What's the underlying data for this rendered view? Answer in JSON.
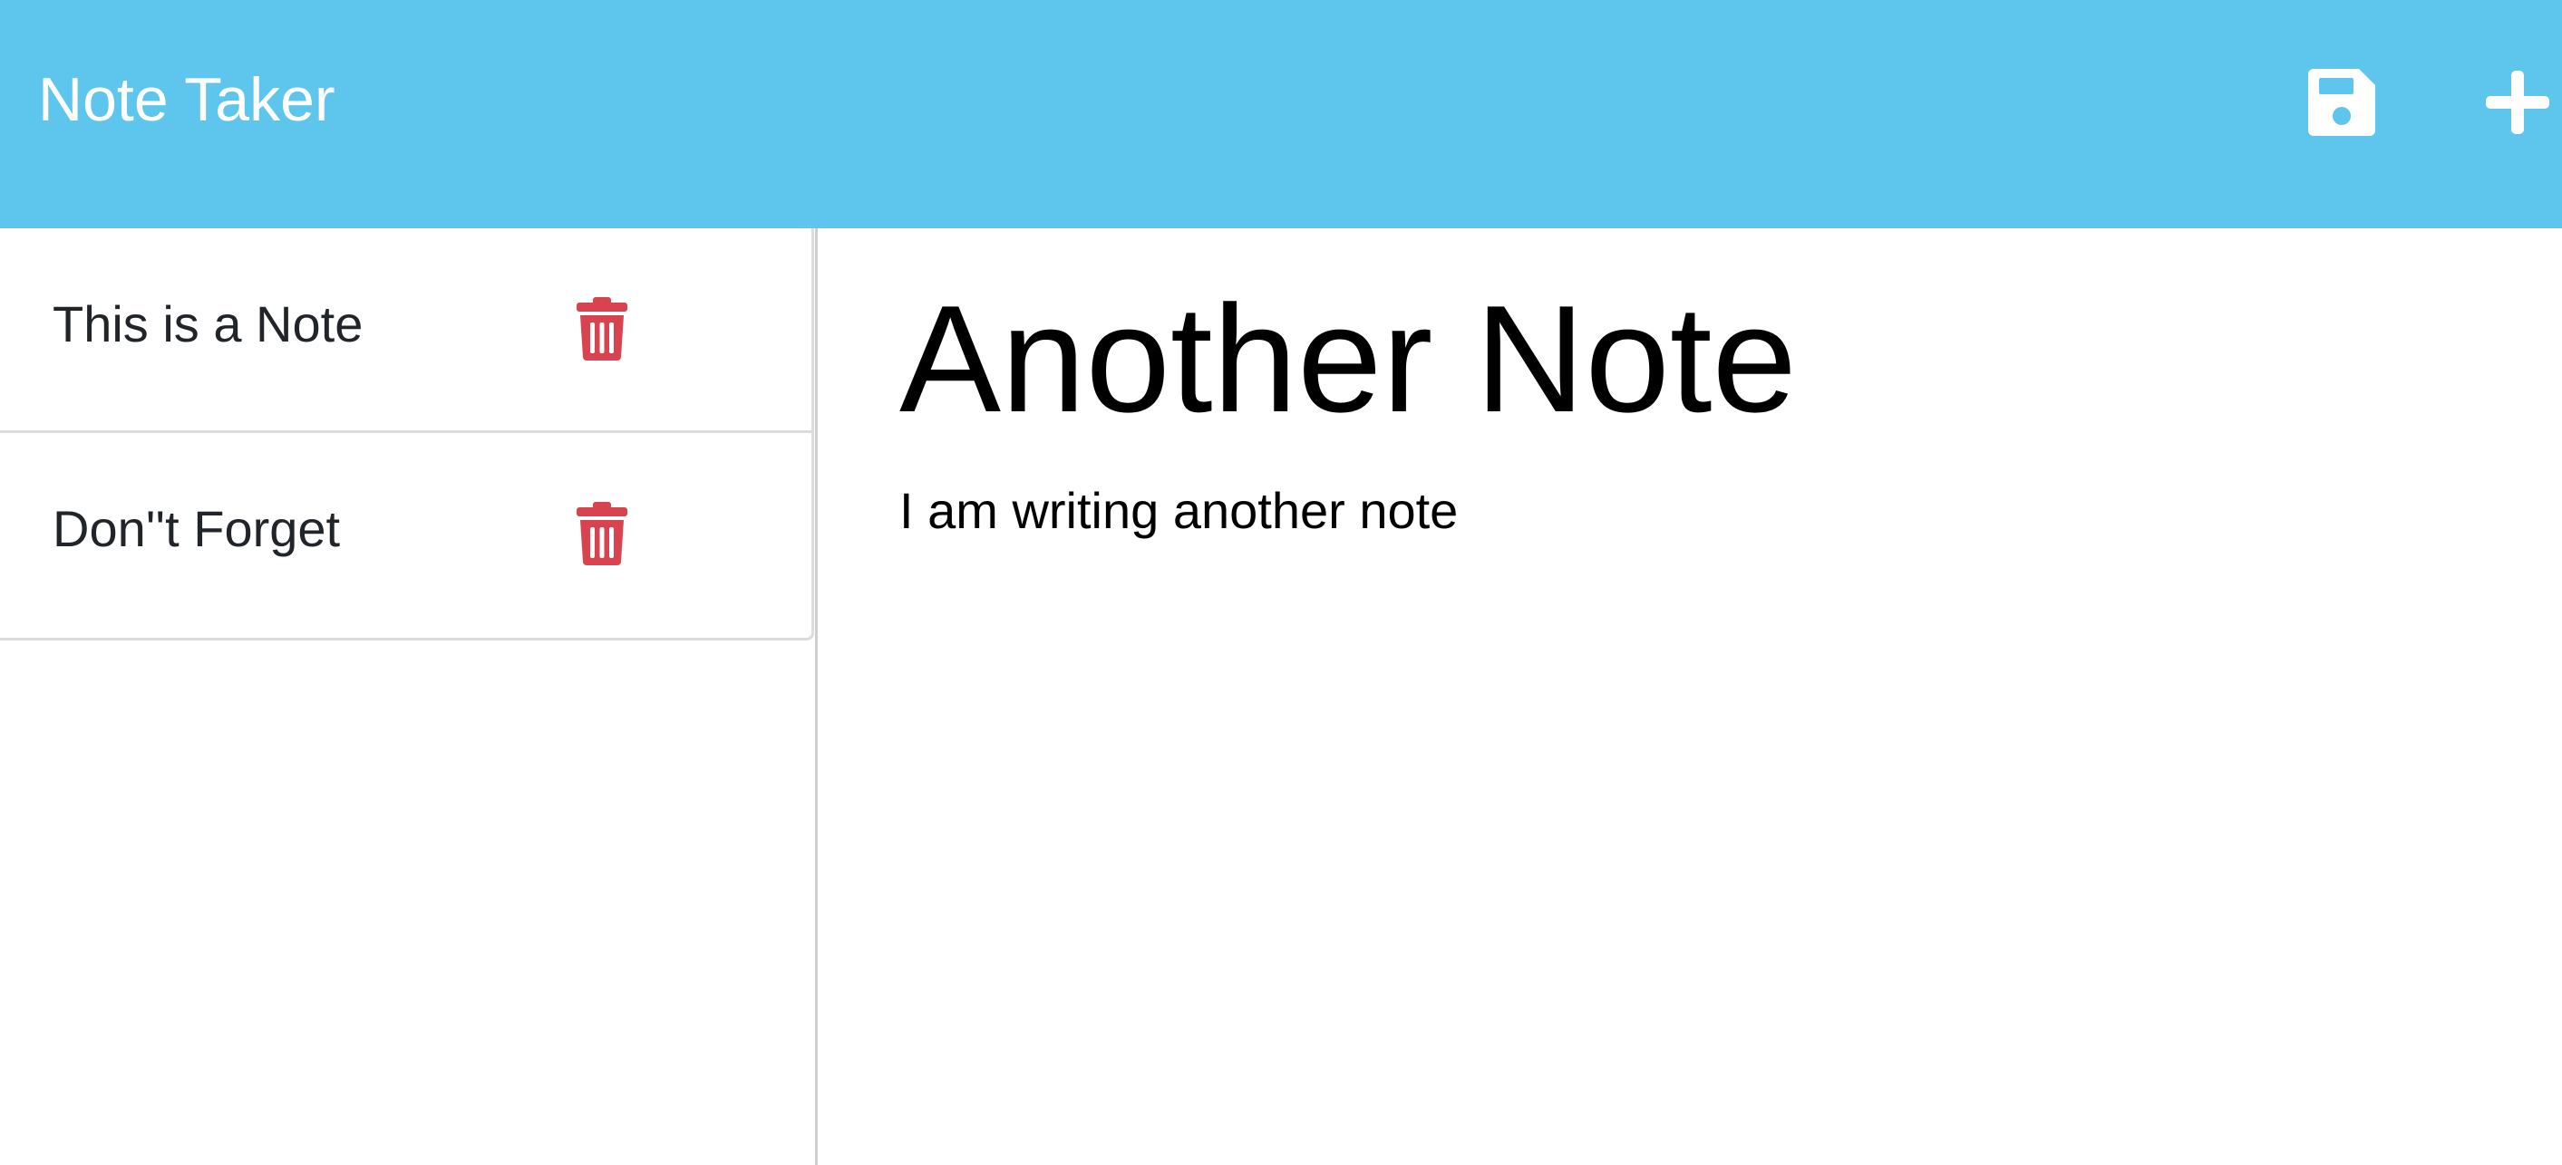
{
  "app": {
    "title": "Note Taker"
  },
  "toolbar": {
    "save_icon": "floppy-disk-icon",
    "new_icon": "plus-icon"
  },
  "colors": {
    "navbar": "#5ec6ec",
    "trash": "#d9434f",
    "text": "#212529"
  },
  "notes": [
    {
      "title": "This is a Note",
      "delete_icon": "trash-icon"
    },
    {
      "title": "Don''t Forget",
      "delete_icon": "trash-icon"
    }
  ],
  "editor": {
    "title_value": "Another Note",
    "text_value": "I am writing another note"
  }
}
